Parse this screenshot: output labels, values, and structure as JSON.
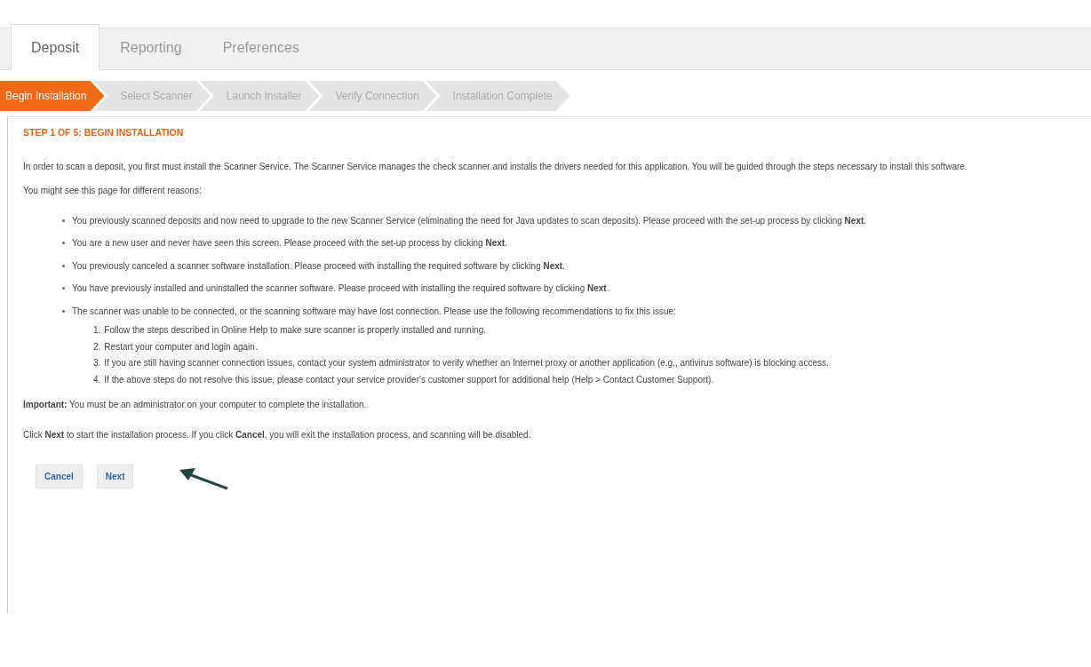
{
  "tabs": [
    {
      "label": "Deposit",
      "selected": true
    },
    {
      "label": "Reporting",
      "selected": false
    },
    {
      "label": "Preferences",
      "selected": false
    }
  ],
  "steps": [
    {
      "label": "Begin Installation",
      "selected": true
    },
    {
      "label": "Select Scanner",
      "selected": false
    },
    {
      "label": "Launch Installer",
      "selected": false
    },
    {
      "label": "Verify Connection",
      "selected": false
    },
    {
      "label": "Installation Complete",
      "selected": false
    }
  ],
  "step_title": "STEP 1 OF 5: BEGIN INSTALLATION",
  "intro": "In order to scan a deposit, you first must install the Scanner Service. The Scanner Service manages the check scanner and installs the drivers needed for this application. You will be guided through the steps necessary to install this software.",
  "reasons_heading": "You might see this page for different reasons:",
  "reasons": [
    {
      "text": "You previously scanned deposits and now need to upgrade to the new Scanner Service (eliminating the need for Java updates to scan deposits). Please proceed with the set-up process by clicking **Next**."
    },
    {
      "text": "You are a new user and never have seen this screen. Please proceed with the set-up process by clicking **Next**."
    },
    {
      "text": "You previously canceled a scanner software installation. Please proceed with installing the required software by clicking **Next**."
    },
    {
      "text": "You have previously installed and uninstalled the scanner software. Please proceed with installing the required software by clicking **Next**."
    },
    {
      "text": "The scanner was unable to be connected, or the scanning software may have lost connection. Please use the following recommendations to fix this issue:",
      "children": [
        {
          "number": "1.",
          "text": "Follow the steps described in Online Help to make sure scanner is properly installed and running."
        },
        {
          "number": "2.",
          "text": "Restart your computer and login again."
        },
        {
          "number": "3.",
          "text": "If you are still having scanner connection issues, contact your system administrator to verify whether an Internet proxy or another application (e.g., antivirus software) is blocking access."
        },
        {
          "number": "4.",
          "text": "If the above steps do not resolve this issue, please contact your service provider's customer support for additional help (Help > Contact Customer Support)."
        }
      ]
    }
  ],
  "important": "**Important:** You must be an administrator on your computer to complete the installation.",
  "instructions": "Click **Next** to start the installation process. If you click **Cancel**, you will exit the installation process, and scanning will be disabled.",
  "buttons": [
    {
      "label": "Cancel"
    },
    {
      "label": "Next"
    }
  ]
}
